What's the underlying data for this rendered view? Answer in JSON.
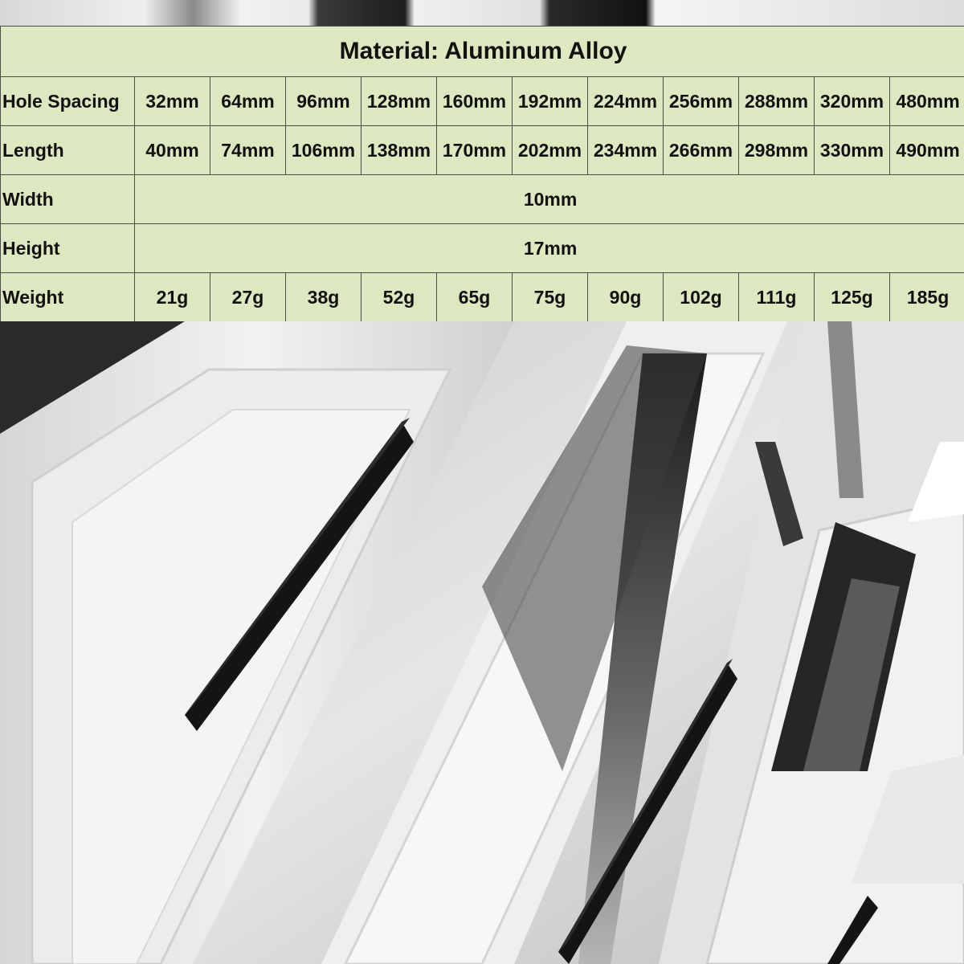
{
  "spec": {
    "title": "Material: Aluminum Alloy",
    "hole_spacing": {
      "label": "Hole Spacing",
      "values": [
        "32mm",
        "64mm",
        "96mm",
        "128mm",
        "160mm",
        "192mm",
        "224mm",
        "256mm",
        "288mm",
        "320mm",
        "480mm"
      ]
    },
    "length": {
      "label": "Length",
      "values": [
        "40mm",
        "74mm",
        "106mm",
        "138mm",
        "170mm",
        "202mm",
        "234mm",
        "266mm",
        "298mm",
        "330mm",
        "490mm"
      ]
    },
    "width": {
      "label": "Width",
      "value": "10mm"
    },
    "height": {
      "label": "Height",
      "value": "17mm"
    },
    "weight": {
      "label": "Weight",
      "values": [
        "21g",
        "27g",
        "38g",
        "52g",
        "65g",
        "75g",
        "90g",
        "102g",
        "111g",
        "125g",
        "185g"
      ]
    }
  },
  "colors": {
    "table_bg": "#dde8c0",
    "border": "#4a4a4a",
    "handle": "#141414",
    "drawer": "#f0f0f0"
  }
}
